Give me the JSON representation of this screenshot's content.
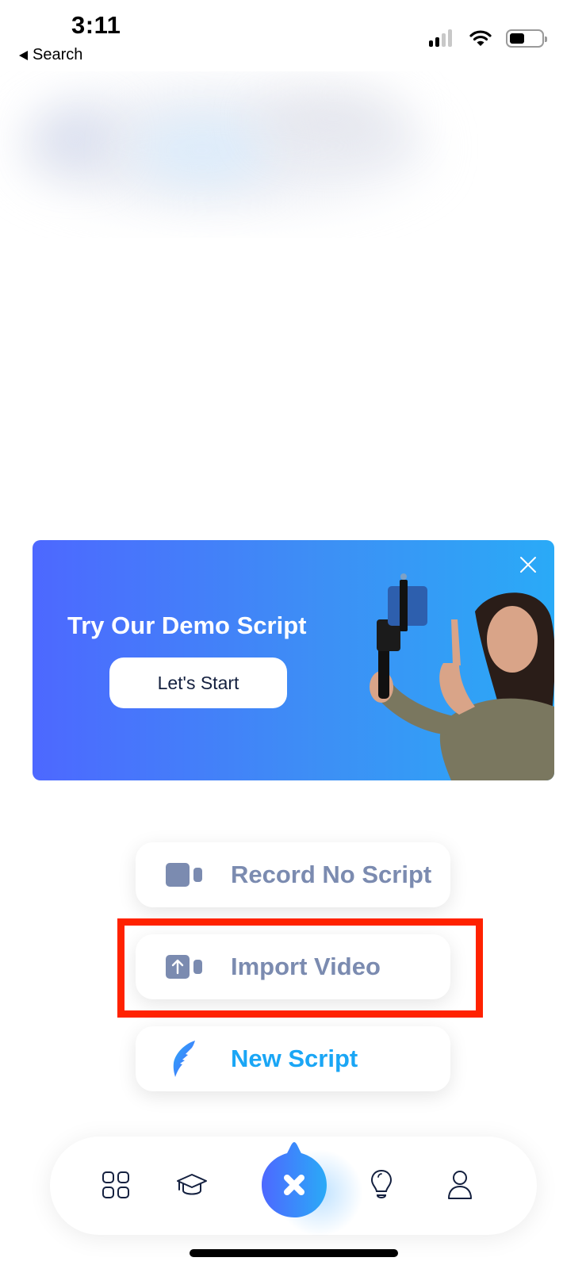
{
  "status_bar": {
    "time": "3:11",
    "back_label": "Search",
    "signal_bars_active": 2,
    "signal_bars_total": 4,
    "battery_percent": 40
  },
  "banner": {
    "title": "Try Our Demo Script",
    "button_label": "Let's Start",
    "close_icon": "close-icon",
    "image": "woman-with-phone-gimbal",
    "gradient_start": "#4d68ff",
    "gradient_end": "#2aaaf7"
  },
  "actions": [
    {
      "label": "Record No Script",
      "icon": "video-camera-icon",
      "color": "#7b8bb0"
    },
    {
      "label": "Import Video",
      "icon": "import-video-icon",
      "color": "#7b8bb0",
      "highlighted": true
    },
    {
      "label": "New Script",
      "icon": "feather-icon",
      "color": "#1aa6f5"
    }
  ],
  "highlight_color": "#ff2200",
  "tabbar": {
    "items": [
      {
        "name": "dashboard",
        "icon": "grid-icon"
      },
      {
        "name": "learn",
        "icon": "graduation-cap-icon"
      },
      {
        "name": "close-menu",
        "icon": "close-icon"
      },
      {
        "name": "ideas",
        "icon": "lightbulb-icon"
      },
      {
        "name": "profile",
        "icon": "person-icon"
      }
    ],
    "icon_color": "#14203f"
  }
}
